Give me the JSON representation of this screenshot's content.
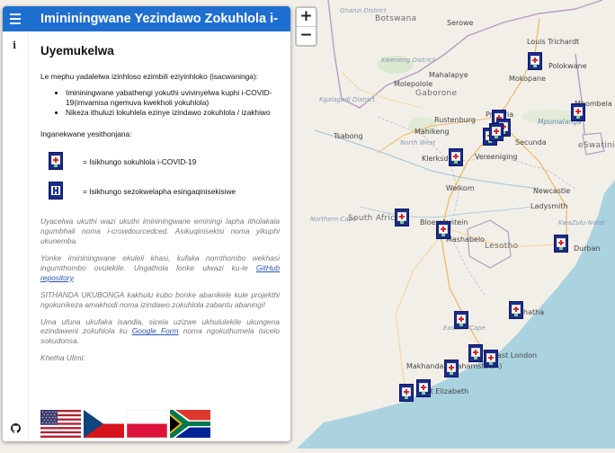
{
  "sidebar": {
    "header_title": "Imininingwane Yezindawo Zokuhlola i-",
    "heading": "Uyemukelwa",
    "intro": "Le mephu yadalelwa izinhloso ezimbili eziyinhloko (isacwaninga):",
    "bullets": [
      "Imininingwane yabathengi yokuthi uvivinyelwa kuphi i-COVID-19(imvamisa ngemuva kwekholi yokuhlola)",
      "Nikeza ithuluzi lokuhlela ezinye izindawo zokuhlola / izakhiwo"
    ],
    "legend_title": "Inganekwane yesithonjana:",
    "legend": [
      {
        "label": "= Isikhungo sokuhlola i-COVID-19",
        "icon": "covid-testing-marker-icon"
      },
      {
        "label": "= Isikhungo sezokwelapha esingaqinisekisiwe",
        "icon": "hospital-marker-icon"
      }
    ],
    "note1": "Uyacelwa ukuthi wazi ukuthi imininingwane eminingi lapha itholakala ngumbhali noma i-crowdourcedced. Asikuqinisekisi noma yikuphi ukunemba.",
    "note2_pre": "Yonke imininingwane ekuleli khasi, kufaka nomthombo wekhasi ingumthombo ovulekile. Ungathola lonke ulwazi ku-le ",
    "note2_link": "GitHub repository",
    "note2_post": ".",
    "note3": "SITHANDA UKUBONGA kakhulu kubo bonke abanikele kule projekthi ngokunikeza amakhodi noma izindawo zokuhlola zabantu abaningi!",
    "note4_pre": "Uma ufuna ukufaka isandla, sicela uzizwe ukhululekile ukungena ezindaweni zokuhlola ku ",
    "note4_link": "Google Form",
    "note4_post": " noma ngokuthumela isicelo sokudonsa.",
    "language_label": "Khetha Ulimi:",
    "languages": [
      "English",
      "Czech",
      "Polish",
      "South Africa"
    ]
  },
  "zoom": {
    "in": "+",
    "out": "−"
  },
  "map": {
    "places": [
      {
        "text": "Ghanzi District",
        "cls": "region"
      },
      {
        "text": "Botswana",
        "cls": "country"
      },
      {
        "text": "Serowe",
        "cls": "city"
      },
      {
        "text": "Louis Trichardt",
        "cls": "city"
      },
      {
        "text": "Kweneng District",
        "cls": "region"
      },
      {
        "text": "Mahalapye",
        "cls": "city"
      },
      {
        "text": "Polokwane",
        "cls": "city"
      },
      {
        "text": "Mokopane",
        "cls": "city"
      },
      {
        "text": "Kgalagadi District",
        "cls": "region"
      },
      {
        "text": "Molepolole",
        "cls": "city"
      },
      {
        "text": "Gaborone",
        "cls": "country"
      },
      {
        "text": "Rustenburg",
        "cls": "city"
      },
      {
        "text": "Pretoria",
        "cls": "city"
      },
      {
        "text": "Mahikeng",
        "cls": "city"
      },
      {
        "text": "Mpumalanga",
        "cls": "region"
      },
      {
        "text": "Tsabong",
        "cls": "city"
      },
      {
        "text": "North West",
        "cls": "region"
      },
      {
        "text": "Secunda",
        "cls": "city"
      },
      {
        "text": "Mbombela",
        "cls": "city"
      },
      {
        "text": "eSwatini",
        "cls": "country"
      },
      {
        "text": "Klerksdorp",
        "cls": "city"
      },
      {
        "text": "Vereeniging",
        "cls": "city"
      },
      {
        "text": "Welkom",
        "cls": "city"
      },
      {
        "text": "Newcastle",
        "cls": "city"
      },
      {
        "text": "Northern Cape",
        "cls": "region"
      },
      {
        "text": "South Africa",
        "cls": "country"
      },
      {
        "text": "Bloemfontein",
        "cls": "city"
      },
      {
        "text": "Ladysmith",
        "cls": "city"
      },
      {
        "text": "KwaZulu-Natal",
        "cls": "region"
      },
      {
        "text": "Mashabelo",
        "cls": "city"
      },
      {
        "text": "Lesotho",
        "cls": "country"
      },
      {
        "text": "Durban",
        "cls": "city"
      },
      {
        "text": "Eastern Cape",
        "cls": "region"
      },
      {
        "text": "East London",
        "cls": "city"
      },
      {
        "text": "Makhanda (Grahamstown)",
        "cls": "city"
      },
      {
        "text": "Port Elizabeth",
        "cls": "city"
      },
      {
        "text": "Mthatha",
        "cls": "city"
      }
    ]
  },
  "colors": {
    "header": "#1f6fd0",
    "marker": "#1b2c8c",
    "water": "#aad3df"
  }
}
